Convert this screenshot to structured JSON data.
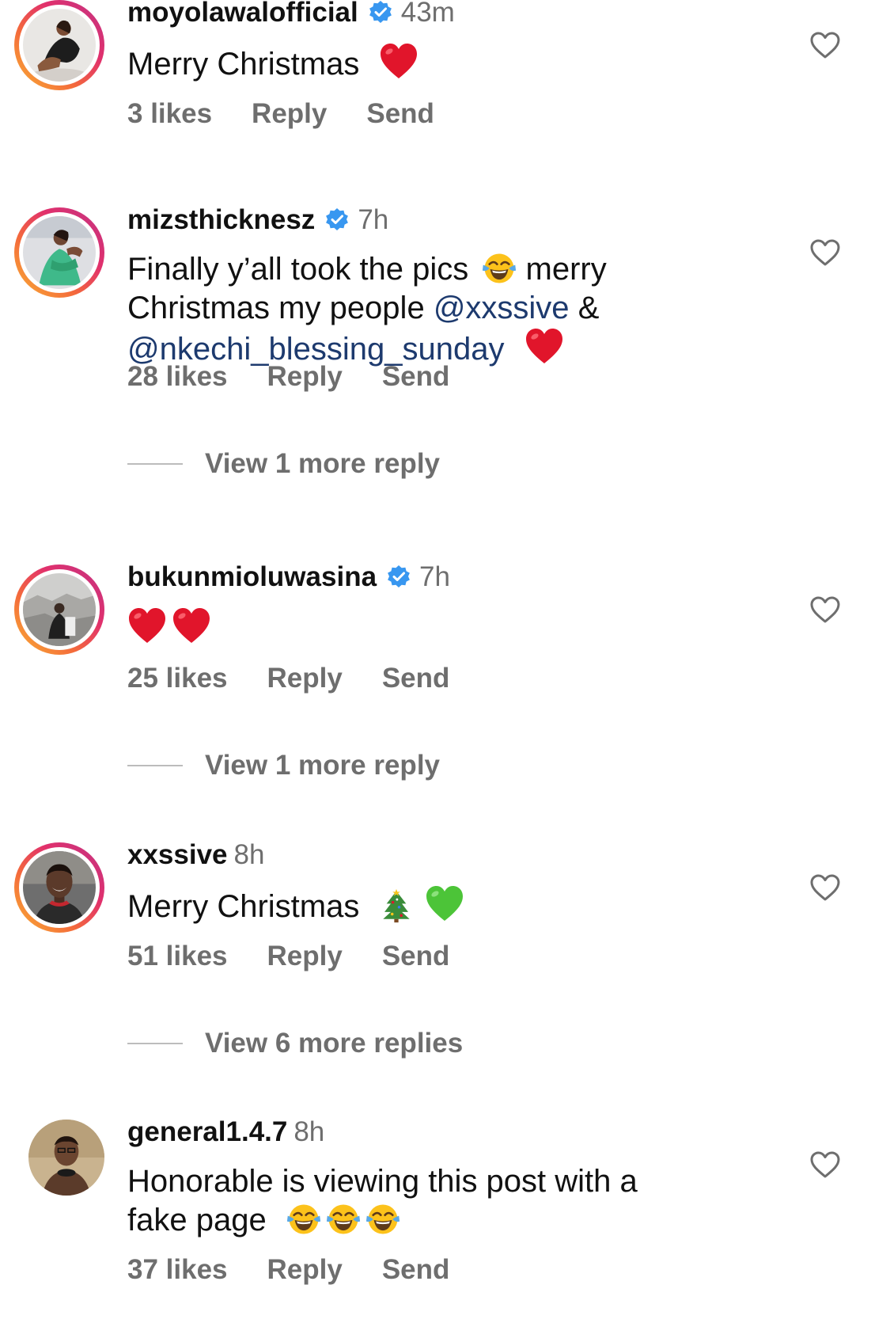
{
  "colors": {
    "text": "#111111",
    "secondary": "#6e6e6e",
    "mention": "#1d3a6e",
    "verified_badge": "#3897f0",
    "heart": "#e1152b",
    "green_heart": "#4cc438"
  },
  "comments": [
    {
      "username": "moyolawalofficial",
      "verified": true,
      "time": "43m",
      "text": "Merry Christmas",
      "emojis": [
        "red-heart"
      ],
      "likes": "3 likes",
      "reply_label": "Reply",
      "send_label": "Send"
    },
    {
      "username": "mizsthicknesz",
      "verified": true,
      "time": "7h",
      "text_part1": "Finally y’all took the pics",
      "emoji1": "face-with-tears-of-joy",
      "text_part2": "merry Christmas my people",
      "mention1": "@xxssive",
      "amp": "&",
      "mention2": "@nkechi_blessing_sunday",
      "emoji2": "red-heart",
      "likes": "28 likes",
      "reply_label": "Reply",
      "send_label": "Send",
      "view_more": "View 1 more reply"
    },
    {
      "username": "bukunmioluwasina",
      "verified": true,
      "time": "7h",
      "emojis": [
        "red-heart",
        "red-heart"
      ],
      "likes": "25 likes",
      "reply_label": "Reply",
      "send_label": "Send",
      "view_more": "View 1 more reply"
    },
    {
      "username": "xxssive",
      "verified": false,
      "time": "8h",
      "text": "Merry Christmas",
      "emojis": [
        "christmas-tree",
        "green-heart"
      ],
      "likes": "51 likes",
      "reply_label": "Reply",
      "send_label": "Send",
      "view_more": "View 6 more replies"
    },
    {
      "username": "general1.4.7",
      "verified": false,
      "time": "8h",
      "text_line1": "Honorable is viewing this post with a",
      "text_line2": "fake page",
      "emojis": [
        "face-with-tears-of-joy",
        "face-with-tears-of-joy",
        "face-with-tears-of-joy"
      ],
      "likes": "37 likes",
      "reply_label": "Reply",
      "send_label": "Send"
    }
  ]
}
